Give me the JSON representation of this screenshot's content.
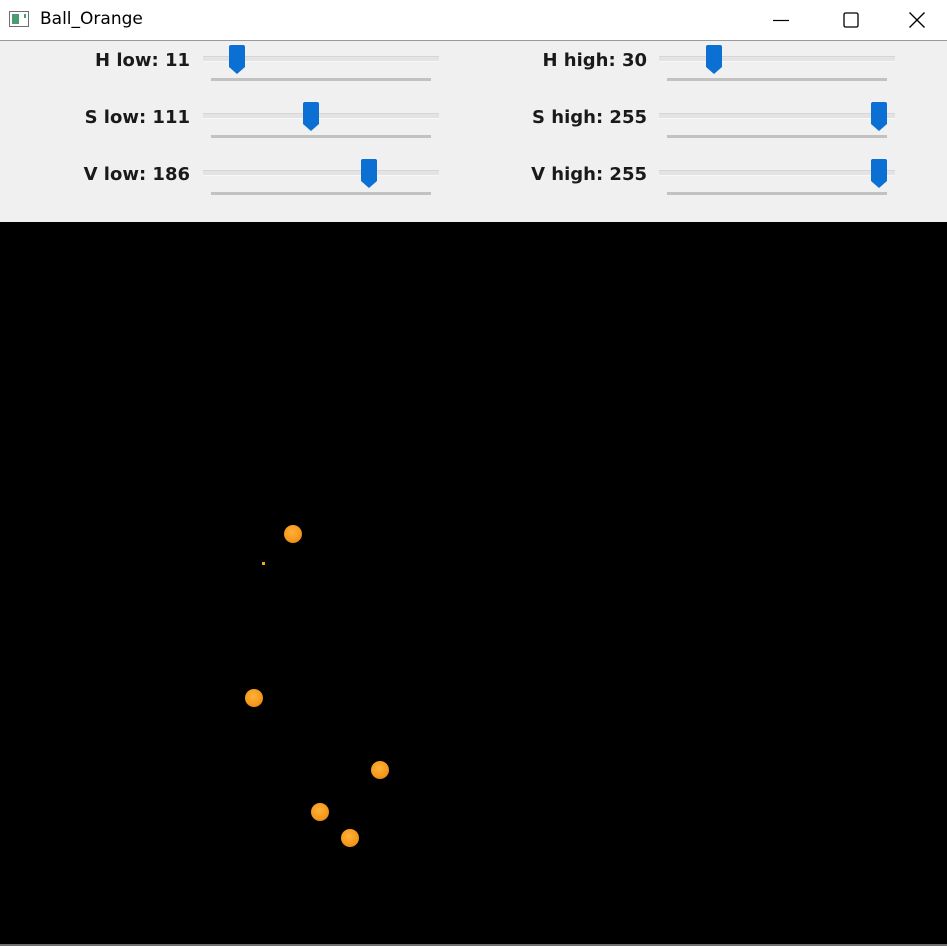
{
  "window": {
    "title": "Ball_Orange",
    "controls": {
      "minimize": "minimize-icon",
      "maximize": "maximize-icon",
      "close": "close-icon"
    }
  },
  "trackbars": [
    {
      "label": "H low: 11",
      "value": 11,
      "max": 179
    },
    {
      "label": "H high: 30",
      "value": 30,
      "max": 179
    },
    {
      "label": "S low: 111",
      "value": 111,
      "max": 255
    },
    {
      "label": "S high: 255",
      "value": 255,
      "max": 255
    },
    {
      "label": "V low: 186",
      "value": 186,
      "max": 255
    },
    {
      "label": "V high: 255",
      "value": 255,
      "max": 255
    }
  ],
  "colors": {
    "thumb": "#0b6fd4",
    "blob": "#f59a1c",
    "background": "#000000",
    "panel": "#f0f0f0"
  }
}
